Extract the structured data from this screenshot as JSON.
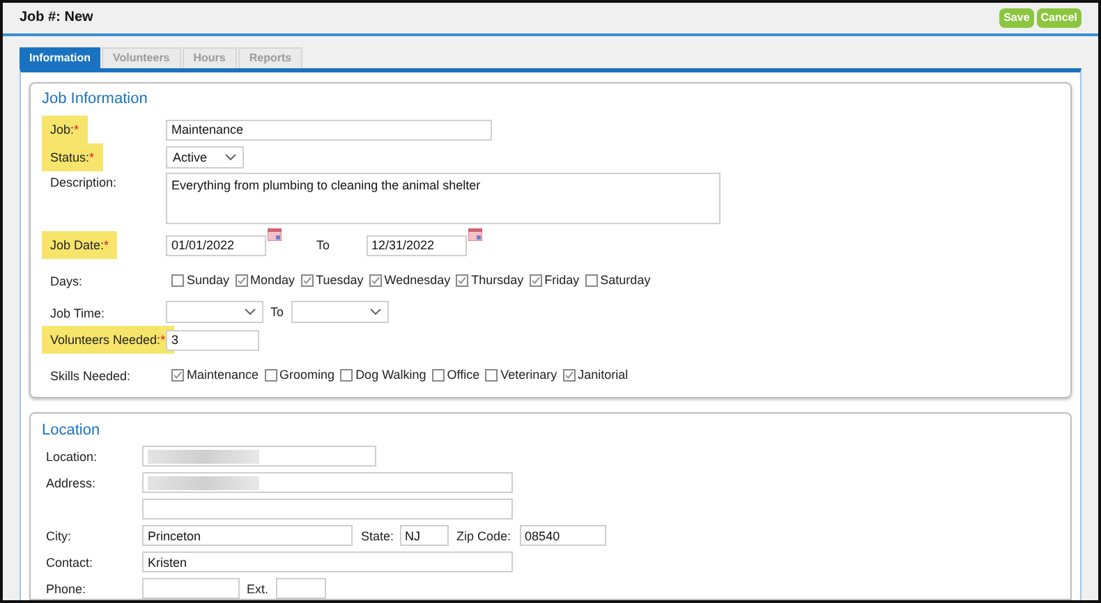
{
  "header": {
    "title": "Job #: New",
    "buttons": [
      "Save",
      "Cancel"
    ]
  },
  "tabs": [
    {
      "label": "Information",
      "selected": true
    },
    {
      "label": "Volunteers",
      "selected": false
    },
    {
      "label": "Hours",
      "selected": false
    },
    {
      "label": "Reports",
      "selected": false
    }
  ],
  "job_information": {
    "title": "Job Information",
    "job": {
      "label": "Job:",
      "mark": "*",
      "required": true,
      "value": "Maintenance"
    },
    "status": {
      "label": "Status:",
      "mark": "*",
      "required": true,
      "value": "Active"
    },
    "description": {
      "label": "Description:",
      "value": "Everything from plumbing to cleaning the animal shelter"
    },
    "job_date": {
      "label": "Job Date:",
      "mark": "*",
      "required": true,
      "from": "01/01/2022",
      "to_label": "To",
      "to": "12/31/2022"
    },
    "days": {
      "label": "Days:",
      "options": [
        {
          "label": "Sunday",
          "checked": false
        },
        {
          "label": "Monday",
          "checked": true
        },
        {
          "label": "Tuesday",
          "checked": true
        },
        {
          "label": "Wednesday",
          "checked": true
        },
        {
          "label": "Thursday",
          "checked": true
        },
        {
          "label": "Friday",
          "checked": true
        },
        {
          "label": "Saturday",
          "checked": false
        }
      ]
    },
    "job_time": {
      "label": "Job Time:",
      "to_label": "To"
    },
    "volunteers_needed": {
      "label": "Volunteers Needed:",
      "mark": "*",
      "required": true,
      "value": "3"
    },
    "skills": {
      "label": "Skills Needed:",
      "options": [
        {
          "label": "Maintenance",
          "checked": true
        },
        {
          "label": "Grooming",
          "checked": false
        },
        {
          "label": "Dog Walking",
          "checked": false
        },
        {
          "label": "Office",
          "checked": false
        },
        {
          "label": "Veterinary",
          "checked": false
        },
        {
          "label": "Janitorial",
          "checked": true
        }
      ]
    }
  },
  "location": {
    "title": "Location",
    "location_label": "Location:",
    "address_label": "Address:",
    "city": {
      "label": "City:",
      "value": "Princeton"
    },
    "state": {
      "label": "State:",
      "value": "NJ"
    },
    "zip": {
      "label": "Zip Code:",
      "value": "08540"
    },
    "contact": {
      "label": "Contact:",
      "value": "Kristen"
    },
    "phone": {
      "label": "Phone:",
      "ext_label": "Ext."
    }
  }
}
